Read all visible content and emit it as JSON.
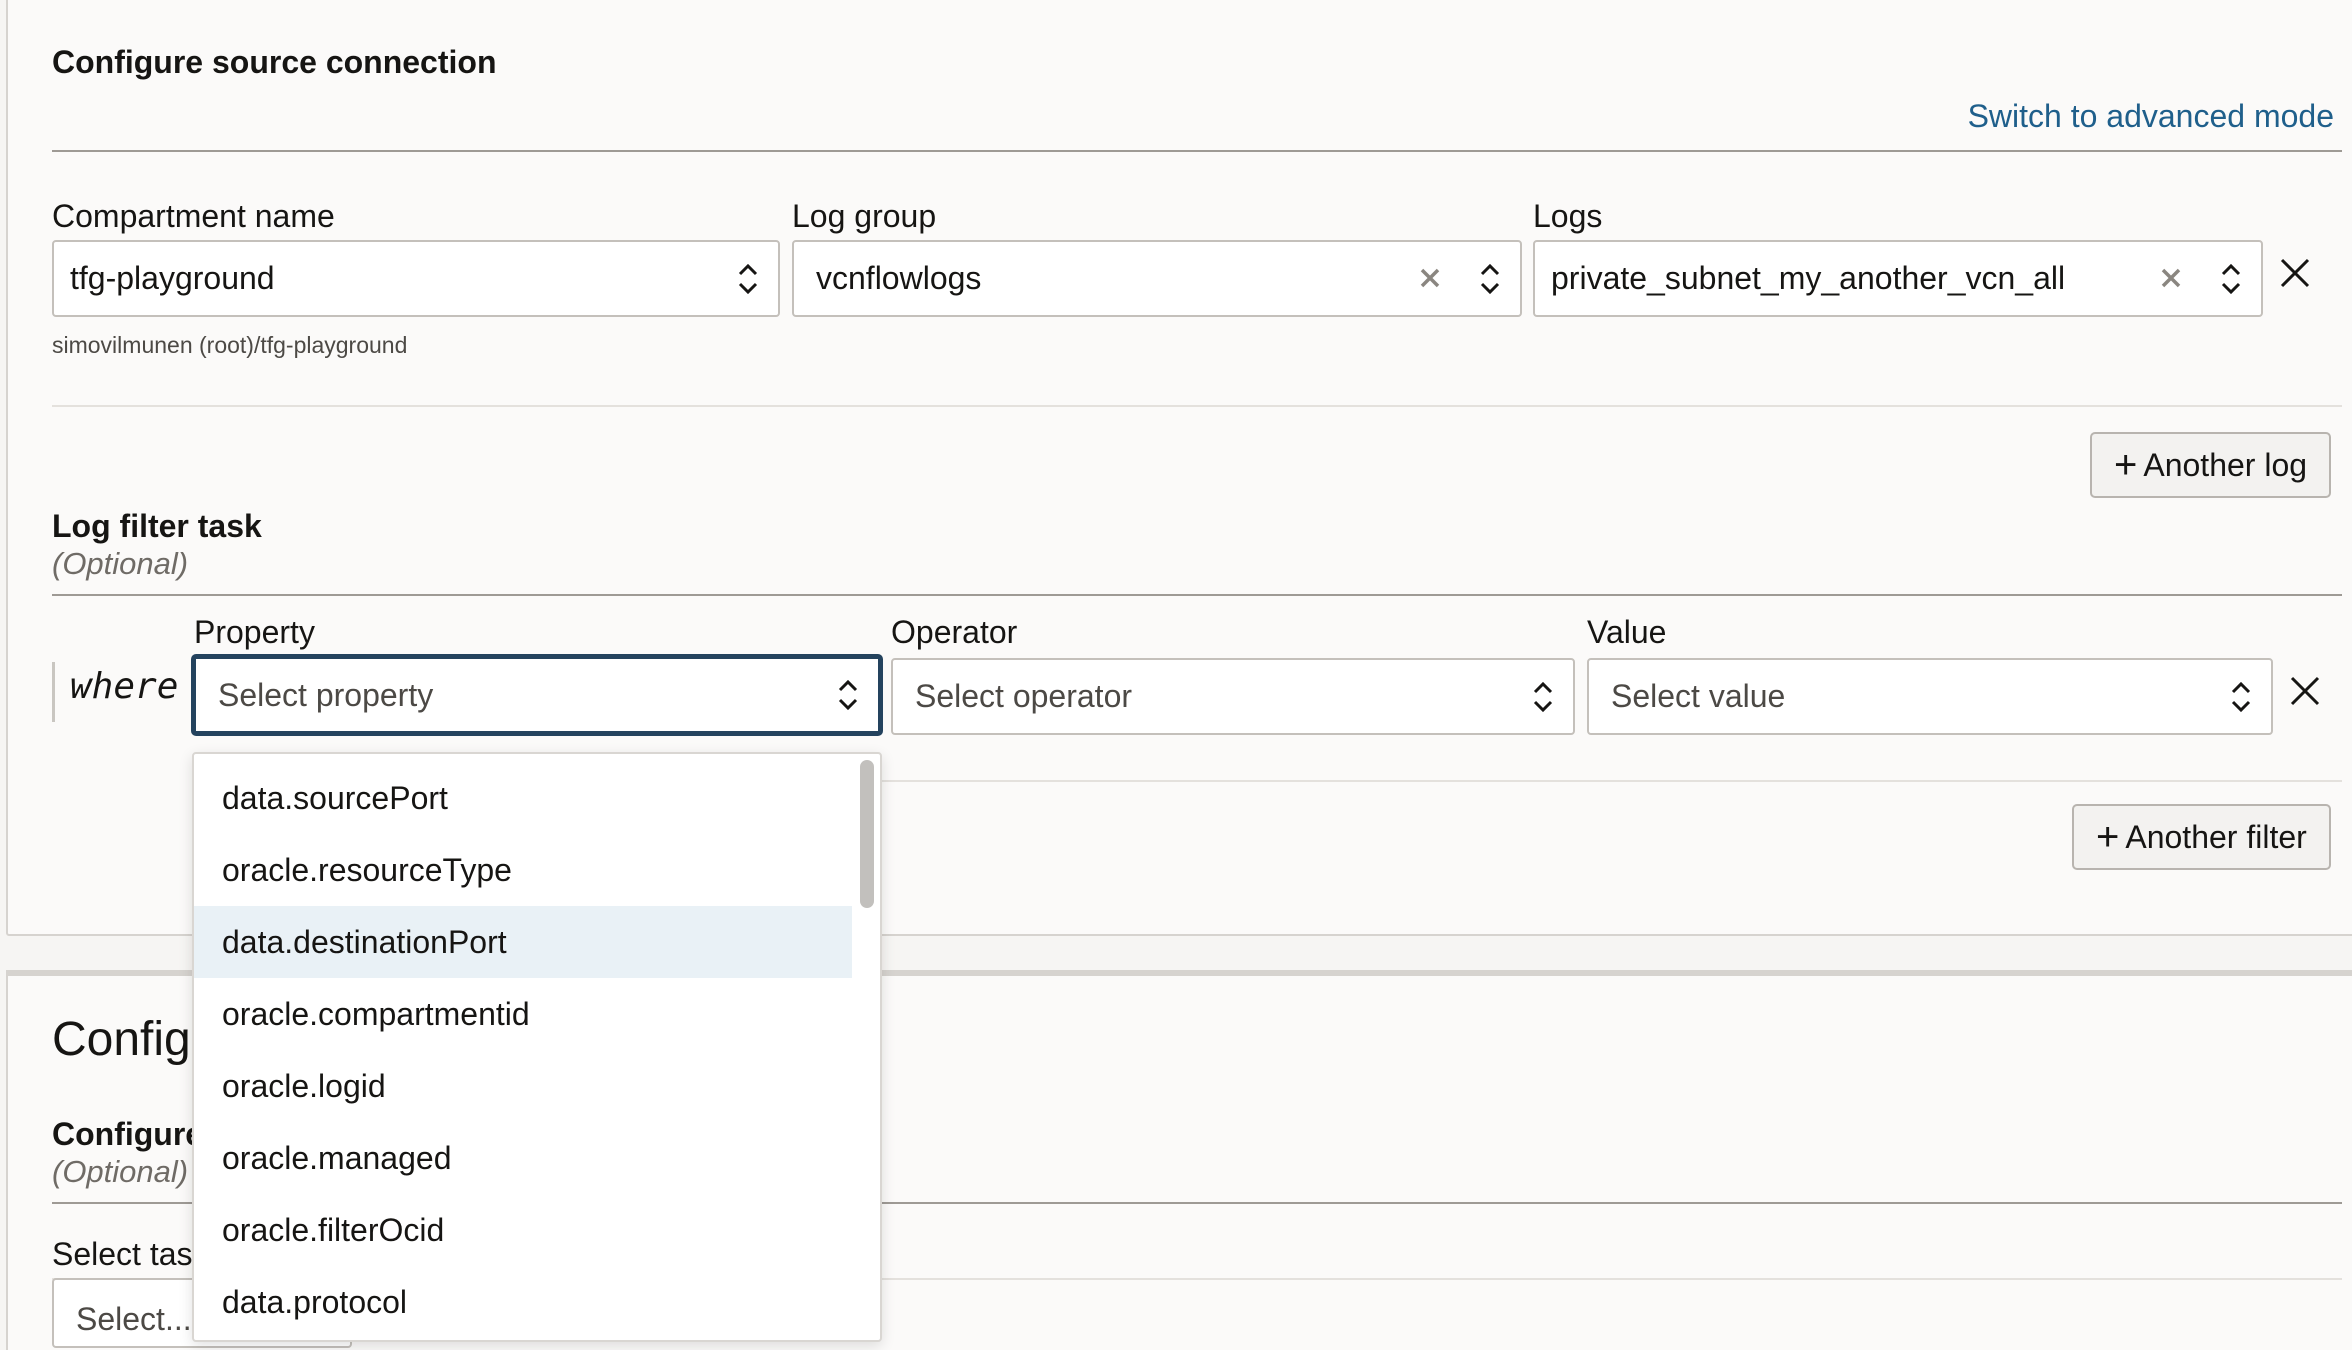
{
  "source": {
    "title": "Configure source connection",
    "advanced_link": "Switch to advanced mode",
    "compartment": {
      "label": "Compartment name",
      "value": "tfg-playground",
      "path": "simovilmunen (root)/tfg-playground"
    },
    "log_group": {
      "label": "Log group",
      "value": "vcnflowlogs"
    },
    "logs": {
      "label": "Logs",
      "value": "private_subnet_my_another_vcn_all"
    },
    "another_log": "Another log"
  },
  "filter": {
    "title": "Log filter task",
    "optional": "(Optional)",
    "where": "where",
    "property": {
      "label": "Property",
      "placeholder": "Select property"
    },
    "operator": {
      "label": "Operator",
      "placeholder": "Select operator"
    },
    "value": {
      "label": "Value",
      "placeholder": "Select value"
    },
    "another_filter": "Another filter",
    "options": [
      "data.sourcePort",
      "oracle.resourceType",
      "data.destinationPort",
      "oracle.compartmentid",
      "oracle.logid",
      "oracle.managed",
      "oracle.filterOcid",
      "data.protocol"
    ],
    "highlighted_option": "data.destinationPort"
  },
  "tasks": {
    "title_partial": "Configu",
    "subtitle_partial": "Configure",
    "optional": "(Optional)",
    "select_label_partial": "Select task",
    "select_placeholder_partial": "Select..."
  }
}
